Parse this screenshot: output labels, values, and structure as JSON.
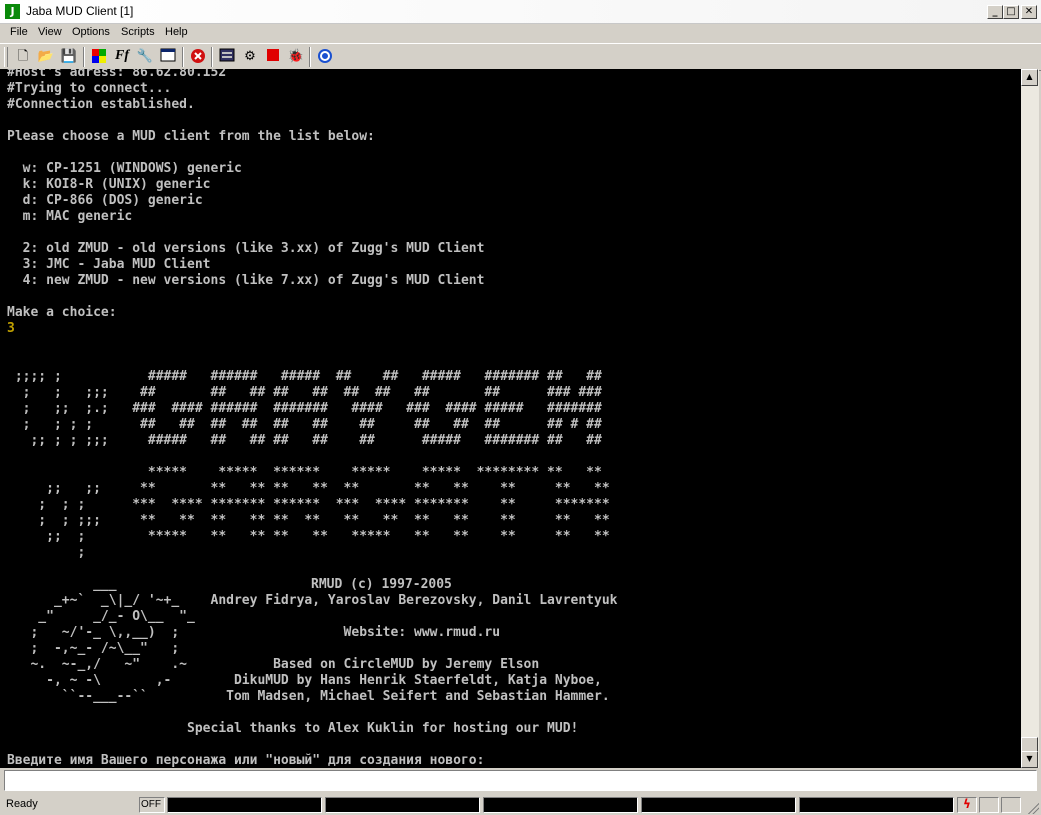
{
  "window": {
    "title": "Jaba MUD Client [1]",
    "icon_letter": "J"
  },
  "menu": [
    "File",
    "View",
    "Options",
    "Scripts",
    "Help"
  ],
  "toolbar_icons": [
    "new-file-icon",
    "open-folder-icon",
    "save-icon",
    "colors-icon",
    "font-icon",
    "wrench-icon",
    "window-icon",
    "disconnect-icon",
    "log-icon",
    "tools-icon",
    "stop-icon",
    "bug-icon",
    "help-icon"
  ],
  "terminal": {
    "text": "#Host's adress: 86.62.80.152\n#Trying to connect...\n#Connection established.\n\nPlease choose a MUD client from the list below:\n\n  w: CP-1251 (WINDOWS) generic\n  k: KOI8-R (UNIX) generic\n  d: CP-866 (DOS) generic\n  m: MAC generic\n\n  2: old ZMUD - old versions (like 3.xx) of Zugg's MUD Client\n  3: JMC - Jaba MUD Client\n  4: new ZMUD - new versions (like 7.xx) of Zugg's MUD Client\n\nMake a choice:",
    "input_echo": "3",
    "art": "\n\n\n ;;;; ;           #####   ######   #####  ##    ##   #####   ####### ##   ##\n  ;   ;   ;;;    ##       ##   ## ##   ##  ##  ##   ##       ##      ### ###\n  ;   ;;  ;.;   ###  #### ######  #######   ####   ###  #### #####   #######\n  ;   ; ; ;      ##   ##  ##  ##  ##   ##    ##     ##   ##  ##      ## # ##\n   ;; ; ; ;;;     #####   ##   ## ##   ##    ##      #####   ####### ##   ##\n\n                  *****    *****  ******    *****    *****  ******** **   **\n     ;;   ;;     **       **   ** **   **  **       **   **    **     **   **\n    ;  ; ;      ***  **** ******* ******  ***  **** *******    **     *******\n    ;  ; ;;;     **   **  **   ** **  **   **   **  **   **    **     **   **\n     ;;  ;        *****   **   ** **   **   *****   **   **    **     **   **\n         ;\n\n           ___\n      _+~`  _\\|_/ '~+_    Andrey Fidrya, Yaroslav Berezovsky, Danil Lavrentyuk\n    _\"     _/_- O\\__  \"_\n   ;   ~/'-_ \\,,__)  ;                     Website: www.rmud.ru\n   ;  -,~_- /~\\__\"   ;\n   ~.  ~-_,/   ~\"    .~           Based on CircleMUD by Jeremy Elson\n     -, ~ -\\       ,-        DikuMUD by Hans Henrik Staerfeldt, Katja Nyboe,\n       ``--___--``          Tom Madsen, Michael Seifert and Sebastian Hammer.\n\n                       Special thanks to Alex Kuklin for hosting our MUD!\n\nВведите имя Вашего персонажа или \"новый\" для создания нового:",
    "rmud_title": "RMUD (c) 1997-2005"
  },
  "command_input": {
    "value": ""
  },
  "status": {
    "ready": "Ready",
    "mode": "OFF"
  }
}
